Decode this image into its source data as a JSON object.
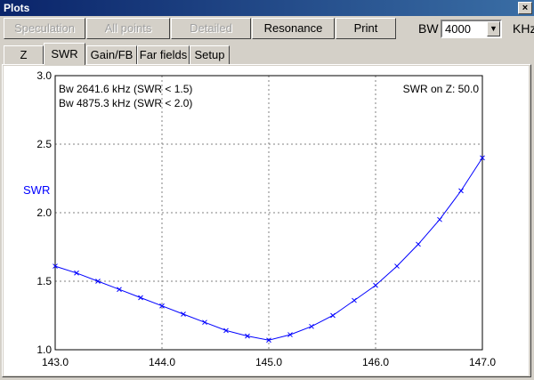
{
  "window": {
    "title": "Plots",
    "close_label": "×"
  },
  "toolbar": {
    "speculation_label": "Speculation",
    "all_points_label": "All points",
    "detailed_label": "Detailed",
    "resonance_label": "Resonance",
    "print_label": "Print",
    "bw_label": "BW",
    "bw_value": "4000",
    "bw_unit": "KHz"
  },
  "tabs": [
    {
      "label": "Z"
    },
    {
      "label": "SWR",
      "active": true
    },
    {
      "label": "Gain/FB"
    },
    {
      "label": "Far fields"
    },
    {
      "label": "Setup"
    }
  ],
  "chart_data": {
    "type": "line",
    "ylabel": "SWR",
    "xlim": [
      143.0,
      147.0
    ],
    "ylim": [
      1.0,
      3.0
    ],
    "x_ticks": [
      "143.0",
      "144.0",
      "145.0",
      "146.0",
      "147.0"
    ],
    "y_ticks": [
      "1.0",
      "1.5",
      "2.0",
      "2.5",
      "3.0"
    ],
    "grid": true,
    "annotations": [
      "Bw 2641.6 kHz (SWR < 1.5)",
      "Bw 4875.3 kHz (SWR < 2.0)",
      "SWR on Z: 50.0"
    ],
    "series": [
      {
        "color": "#0000ff",
        "marker": "x",
        "x": [
          143.0,
          143.2,
          143.4,
          143.6,
          143.8,
          144.0,
          144.2,
          144.4,
          144.6,
          144.8,
          145.0,
          145.2,
          145.4,
          145.6,
          145.8,
          146.0,
          146.2,
          146.4,
          146.6,
          146.8,
          147.0
        ],
        "y": [
          1.61,
          1.56,
          1.5,
          1.44,
          1.38,
          1.32,
          1.26,
          1.2,
          1.14,
          1.1,
          1.07,
          1.11,
          1.17,
          1.25,
          1.36,
          1.47,
          1.61,
          1.77,
          1.95,
          2.16,
          2.4
        ]
      }
    ]
  }
}
